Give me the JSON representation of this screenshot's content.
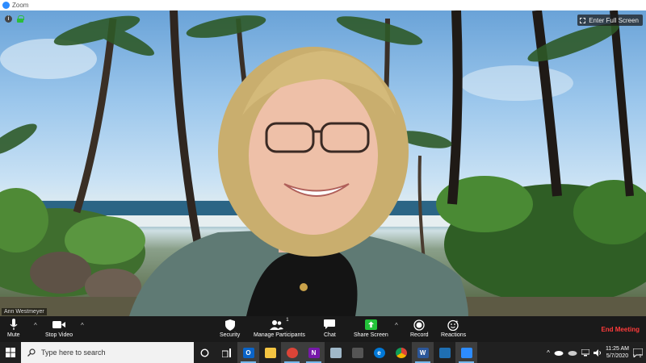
{
  "window": {
    "title": "Zoom"
  },
  "video": {
    "fullscreen_label": "Enter Full Screen",
    "participant_name": "Ann Westmeyer"
  },
  "toolbar": {
    "mute_label": "Mute",
    "stop_video_label": "Stop Video",
    "security_label": "Security",
    "participants_label": "Manage Participants",
    "participants_count": "1",
    "chat_label": "Chat",
    "share_label": "Share Screen",
    "record_label": "Record",
    "reactions_label": "Reactions",
    "end_label": "End Meeting"
  },
  "taskbar": {
    "search_placeholder": "Type here to search",
    "time": "11:25 AM",
    "date": "5/7/2020",
    "apps": [
      "cortana",
      "task-view",
      "outlook",
      "file-explorer",
      "chrome-badge",
      "onenote",
      "paint",
      "calculator",
      "edge",
      "chrome",
      "word",
      "photos",
      "zoom"
    ]
  },
  "colors": {
    "accent": "#2d8cff",
    "end_meeting": "#ff3b3b",
    "share_green": "#23c33a"
  }
}
